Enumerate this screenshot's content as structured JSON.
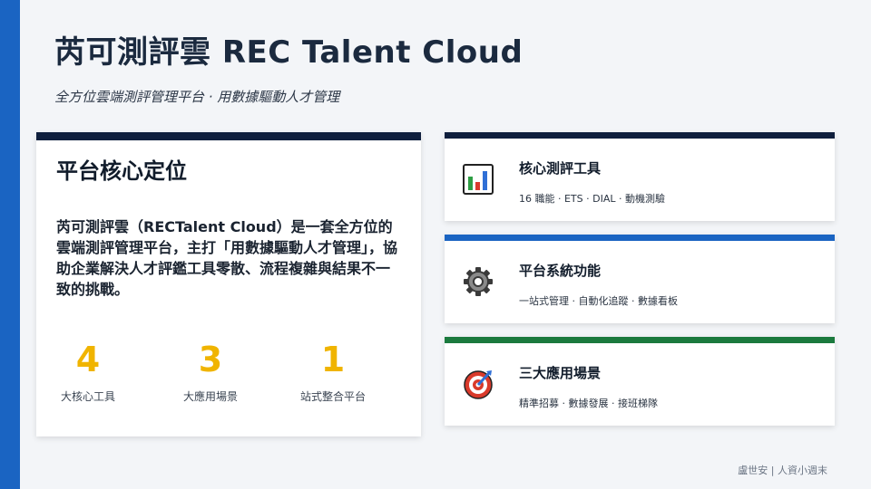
{
  "header": {
    "title": "芮可測評雲  REC Talent Cloud",
    "subtitle": "全方位雲端測評管理平台 ·  用數據驅動人才管理"
  },
  "main_card": {
    "heading": "平台核心定位",
    "description": "芮可測評雲（RECTalent Cloud）是一套全方位的雲端測評管理平台，主打「用數據驅動人才管理」，協助企業解決人才評鑑工具零散、流程複雜與結果不一致的挑戰。",
    "stats": [
      {
        "value": "4",
        "label": "大核心工具"
      },
      {
        "value": "3",
        "label": "大應用場景"
      },
      {
        "value": "1",
        "label": "站式整合平台"
      }
    ],
    "accent_color": "#0f1f3d",
    "stat_color": "#f0b400"
  },
  "features": [
    {
      "title": "核心測評工具",
      "subtitle": "16 職能 · ETS · DIAL · 動機測驗",
      "icon": "bar-chart-icon",
      "accent_color": "#0f1f3d"
    },
    {
      "title": "平台系統功能",
      "subtitle": "一站式管理 · 自動化追蹤 · 數據看板",
      "icon": "gear-icon",
      "accent_color": "#1a64c2"
    },
    {
      "title": "三大應用場景",
      "subtitle": "精準招募 · 數據發展 · 接班梯隊",
      "icon": "target-icon",
      "accent_color": "#1b7a3e"
    }
  ],
  "footer": {
    "credit": "盧世安 | 人資小週末"
  },
  "colors": {
    "left_bar": "#1a64c2",
    "background": "#f3f5f8"
  }
}
